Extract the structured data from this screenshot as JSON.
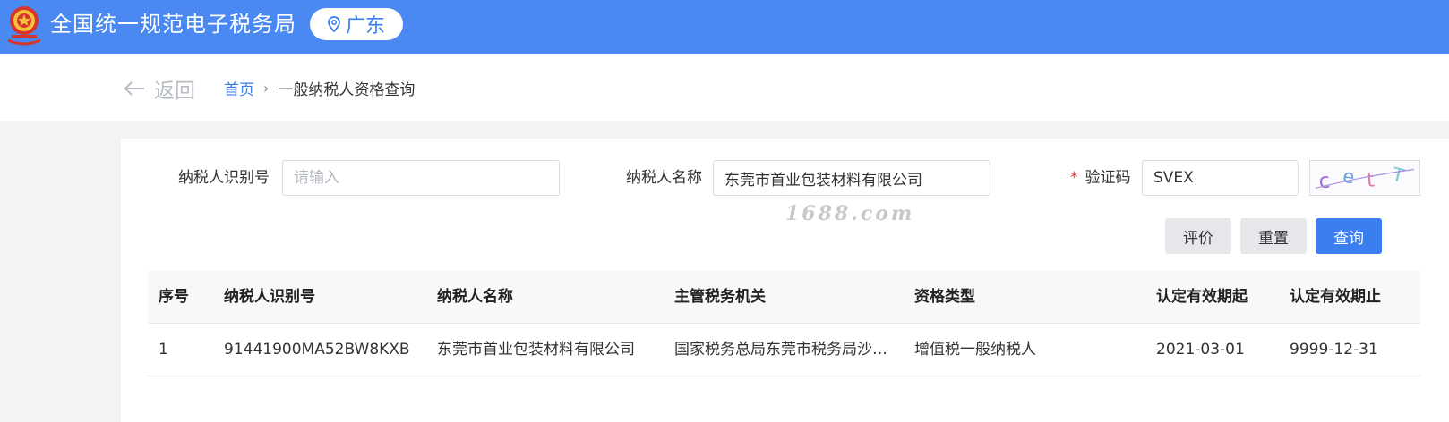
{
  "header": {
    "title": "全国统一规范电子税务局",
    "region": "广东",
    "colors": {
      "bar": "#4a88f2",
      "accent": "#3a7ef0"
    }
  },
  "nav": {
    "back_label": "返回",
    "breadcrumb_home": "首页",
    "breadcrumb_separator": "›",
    "breadcrumb_current": "一般纳税人资格查询"
  },
  "form": {
    "taxpayer_id_label": "纳税人识别号",
    "taxpayer_id_value": "",
    "taxpayer_id_placeholder": "请输入",
    "taxpayer_name_label": "纳税人名称",
    "taxpayer_name_value": "东莞市首业包装材料有限公司",
    "captcha_required_mark": "*",
    "captcha_label": "验证码",
    "captcha_value": "SVEX",
    "captcha_image_text": "cetT"
  },
  "watermark": "1688.com",
  "buttons": {
    "rate": "评价",
    "reset": "重置",
    "search": "查询"
  },
  "table": {
    "headers": [
      "序号",
      "纳税人识别号",
      "纳税人名称",
      "主管税务机关",
      "资格类型",
      "认定有效期起",
      "认定有效期止"
    ],
    "rows": [
      [
        "1",
        "91441900MA52BW8KXB",
        "东莞市首业包装材料有限公司",
        "国家税务总局东莞市税务局沙…",
        "增值税一般纳税人",
        "2021-03-01",
        "9999-12-31"
      ]
    ]
  }
}
